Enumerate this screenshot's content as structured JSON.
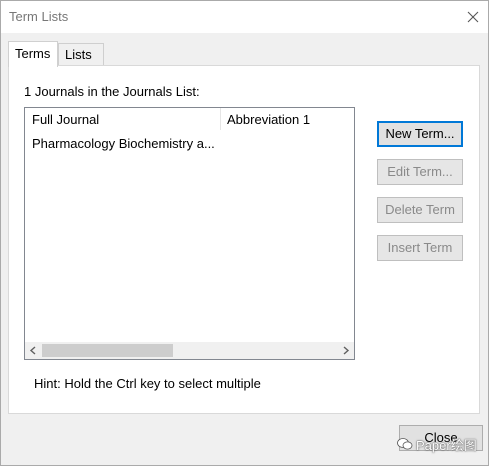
{
  "window": {
    "title": "Term Lists"
  },
  "tabs": [
    {
      "label": "Terms",
      "active": true
    },
    {
      "label": "Lists",
      "active": false
    }
  ],
  "list": {
    "caption": "1 Journals in the Journals List:",
    "columns": [
      "Full Journal",
      "Abbreviation 1"
    ],
    "rows": [
      {
        "full": "Pharmacology Biochemistry a...",
        "abbr": ""
      }
    ]
  },
  "buttons": {
    "new_term": "New Term...",
    "edit_term": "Edit Term...",
    "delete_term": "Delete Term",
    "insert_term": "Insert Term",
    "close": "Close"
  },
  "hint": "Hint: Hold the Ctrl key to select multiple",
  "watermark": {
    "text": "Paper绘图"
  },
  "colors": {
    "accent": "#0078d7",
    "disabled_text": "#8a8a8a"
  },
  "icons": {
    "window_close": "close-icon",
    "scroll_left": "chevron-left-icon",
    "scroll_right": "chevron-right-icon",
    "watermark": "wechat-icon"
  }
}
